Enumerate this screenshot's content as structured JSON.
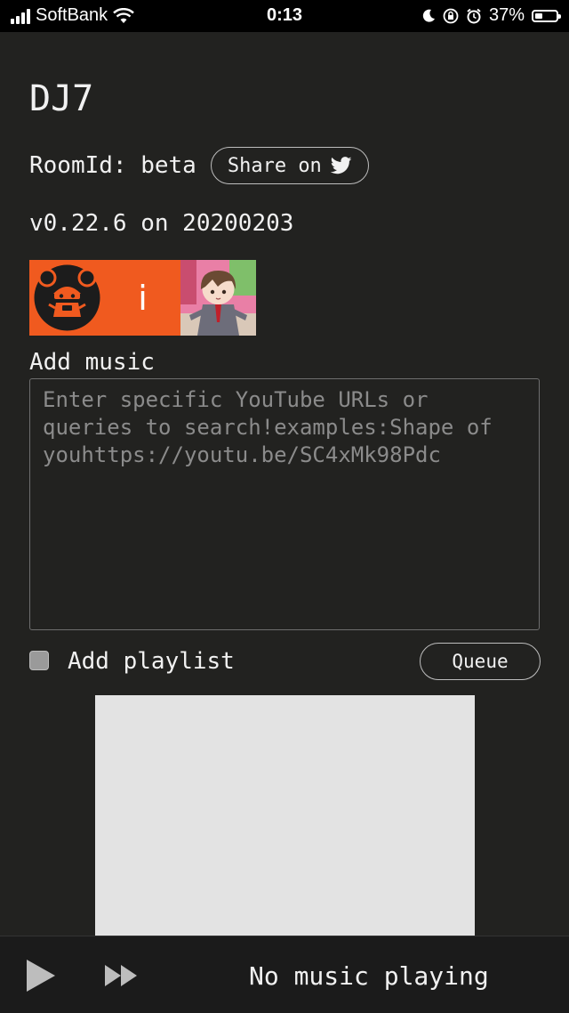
{
  "status_bar": {
    "carrier": "SoftBank",
    "time": "0:13",
    "battery_percent": "37%",
    "battery_level": 0.37,
    "icons": [
      "signal-icon",
      "wifi-icon",
      "moon-icon",
      "orientation-lock-icon",
      "alarm-icon",
      "battery-icon"
    ]
  },
  "header": {
    "title": "DJ7"
  },
  "room": {
    "label": "RoomId: beta",
    "share_label": "Share on"
  },
  "version": {
    "text": "v0.22.6 on 20200203"
  },
  "avatars": [
    {
      "name": "avatar-robot",
      "text": ""
    },
    {
      "name": "avatar-letter",
      "text": "i"
    },
    {
      "name": "avatar-anime",
      "text": ""
    }
  ],
  "add_music": {
    "label": "Add music",
    "placeholder": "Enter specific YouTube URLs or queries to search!examples:Shape of youhttps://youtu.be/SC4xMk98Pdc",
    "value": ""
  },
  "playlist": {
    "label": "Add playlist",
    "checked": false,
    "queue_label": "Queue"
  },
  "player": {
    "status": "No music playing"
  },
  "colors": {
    "background": "#222220",
    "avatar_orange": "#f05a1f",
    "video_placeholder": "#e3e3e3"
  }
}
